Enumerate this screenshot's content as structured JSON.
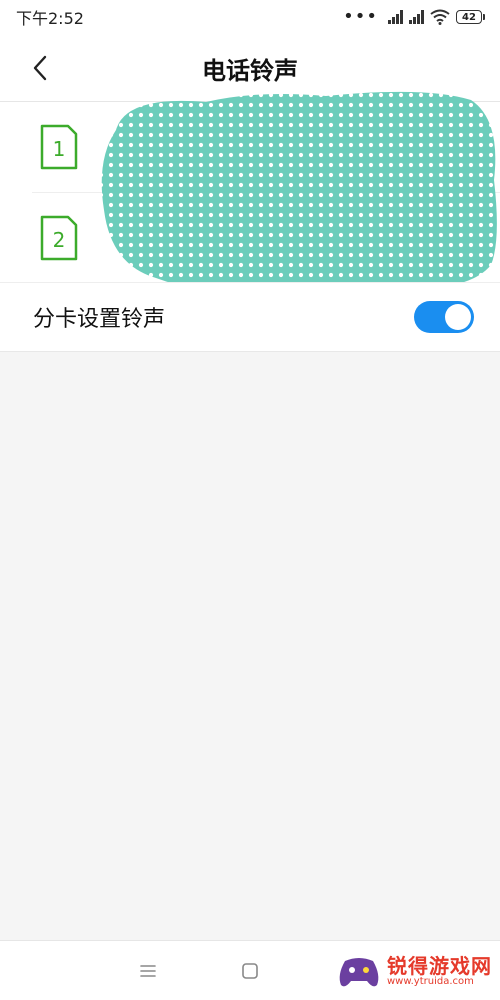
{
  "status_bar": {
    "time": "下午2:52",
    "dots": "•••",
    "battery_level": "42",
    "icons": [
      "signal-icon",
      "signal-icon",
      "wifi-icon",
      "battery-icon"
    ]
  },
  "header": {
    "title": "电话铃声",
    "back_icon": "chevron-left-icon"
  },
  "sim_rows": [
    {
      "sim_number": "1",
      "value": ""
    },
    {
      "sim_number": "2",
      "value": ""
    }
  ],
  "separate_ringtone": {
    "label": "分卡设置铃声",
    "enabled": true
  },
  "nav_bar": {
    "icons": [
      "menu-icon",
      "home-icon",
      "back-icon"
    ]
  },
  "watermark": {
    "title": "锐得游戏网",
    "url": "www.ytruida.com"
  },
  "colors": {
    "accent": "#1a8ef0",
    "sim_icon": "#3cab2b",
    "redaction": "#6ccdbb",
    "watermark": "#e53a2b"
  }
}
